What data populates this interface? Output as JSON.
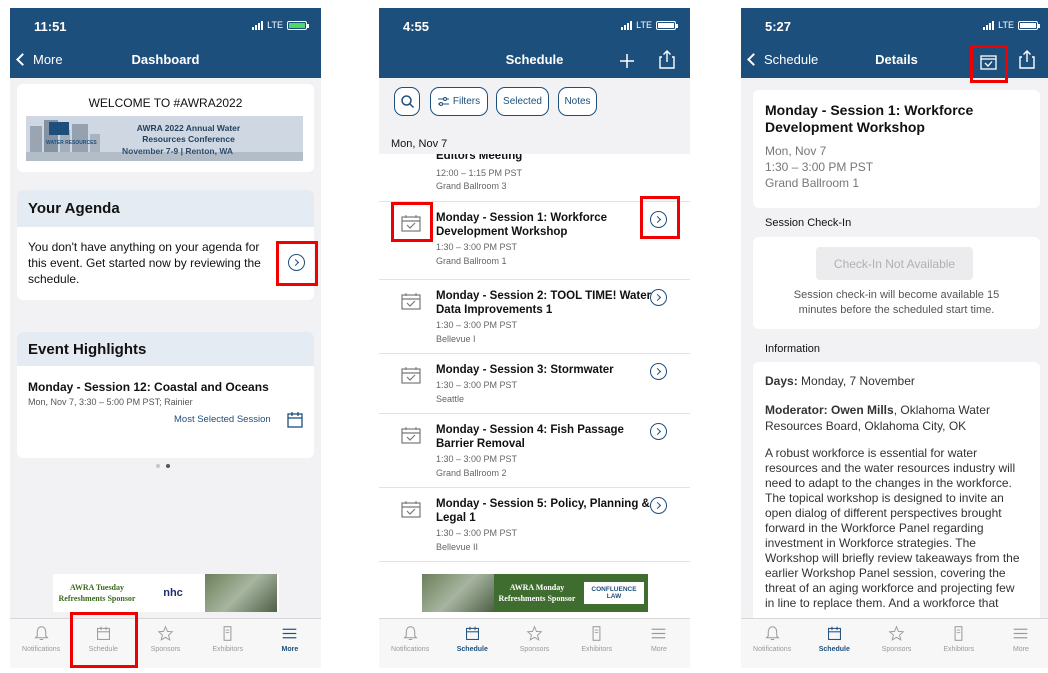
{
  "phone1": {
    "time": "11:51",
    "network": "LTE",
    "back_label": "More",
    "title": "Dashboard",
    "welcome_text": "WELCOME TO #AWRA2022",
    "banner_title": "AWRA 2022 Annual Water Resources Conference",
    "banner_dates": "November 7-9 | Renton, WA",
    "banner_logo_text": "WATER RESOURCES",
    "agenda_heading": "Your Agenda",
    "agenda_message": "You don't have anything on your agenda for this event. Get started now by reviewing the schedule.",
    "highlights_heading": "Event Highlights",
    "highlight_title": "Monday - Session 12: Coastal and Oceans",
    "highlight_meta": "Mon, Nov 7, 3:30 – 5:00 PM PST; Rainier",
    "highlight_tag": "Most Selected Session",
    "sponsor_text": "AWRA Tuesday Refreshments Sponsor",
    "sponsor_logo": "nhc",
    "active_tab": "Schedule"
  },
  "phone2": {
    "time": "4:55",
    "network": "LTE",
    "title": "Schedule",
    "filters": [
      "Filters",
      "Selected",
      "Notes"
    ],
    "date_header": "Mon, Nov 7",
    "partial_item": {
      "title": "Editors Meeting",
      "time": "12:00 – 1:15 PM PST",
      "room": "Grand Ballroom 3"
    },
    "sessions": [
      {
        "title": "Monday - Session 1: Workforce Development Workshop",
        "time": "1:30 – 3:00 PM PST",
        "room": "Grand Ballroom 1"
      },
      {
        "title": "Monday - Session 2: TOOL TIME! Water Data Improvements 1",
        "time": "1:30 – 3:00 PM PST",
        "room": "Bellevue I"
      },
      {
        "title": "Monday - Session 3: Stormwater",
        "time": "1:30 – 3:00 PM PST",
        "room": "Seattle"
      },
      {
        "title": "Monday - Session 4: Fish Passage Barrier Removal",
        "time": "1:30 – 3:00 PM PST",
        "room": "Grand Ballroom 2"
      },
      {
        "title": "Monday - Session 5: Policy, Planning & Legal 1",
        "time": "1:30 – 3:00 PM PST",
        "room": "Bellevue II"
      }
    ],
    "sponsor_text": "AWRA Monday Refreshments Sponsor",
    "sponsor_logo": "CONFLUENCE LAW",
    "active_tab": "Schedule"
  },
  "phone3": {
    "time": "5:27",
    "network": "LTE",
    "back_label": "Schedule",
    "title": "Details",
    "session_title": "Monday - Session 1: Workforce Development Workshop",
    "session_date": "Mon, Nov 7",
    "session_time": "1:30 – 3:00 PM PST",
    "session_room": "Grand Ballroom 1",
    "checkin_heading": "Session Check-In",
    "checkin_button": "Check-In Not Available",
    "checkin_note": "Session check-in will become available 15 minutes before the scheduled start time.",
    "info_heading": "Information",
    "days_label": "Days:",
    "days_value": "Monday, 7 November",
    "moderator_label": "Moderator: Owen Mills",
    "moderator_value": ", Oklahoma Water Resources Board, Oklahoma City, OK",
    "description": "A robust workforce is essential for water resources and the water resources industry will need to adapt to the changes in the workforce. The topical workshop is designed to invite an open dialog of different perspectives brought forward in the Workforce Panel regarding investment in Workforce strategies. The Workshop will briefly review takeaways from the earlier Workshop Panel session, covering the threat of an aging workforce and projecting few in line to replace them. And a workforce that",
    "active_tab": "Schedule"
  },
  "tabs": [
    "Notifications",
    "Schedule",
    "Sponsors",
    "Exhibitors",
    "More"
  ],
  "colors": {
    "brand": "#1d4f7c",
    "highlight": "#f20000",
    "background": "#f2f2f4"
  }
}
